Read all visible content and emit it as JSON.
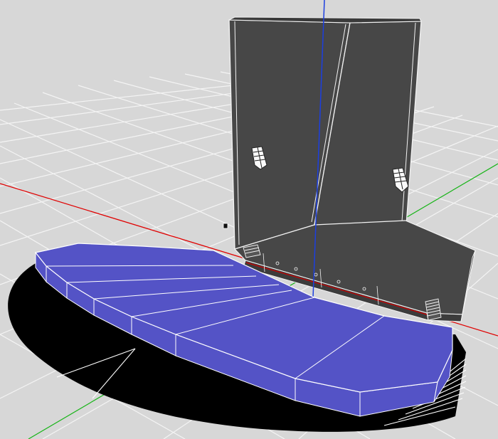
{
  "viewport": {
    "background_color": "#d7d7d7",
    "grid_color": "#f2f2f2",
    "axis_x_color": "#e00000",
    "axis_y_color": "#10b000",
    "axis_z_color": "#1c3fe0",
    "wall_color": "#474747",
    "wall_edge_color": "#f5f5f5",
    "platform_top_color": "#5453c6",
    "platform_side_color": "#5453c6",
    "shadow_color": "#000000",
    "objects": [
      "grid-floor",
      "x-axis",
      "y-axis",
      "z-axis",
      "corner-walls",
      "wall-speaker-left",
      "wall-speaker-right",
      "stage-floor",
      "stage-steps",
      "curved-platform",
      "platform-shadow"
    ]
  }
}
